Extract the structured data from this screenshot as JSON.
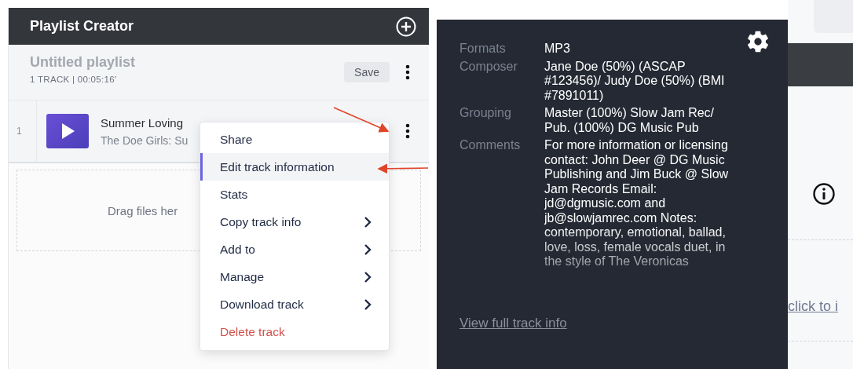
{
  "panel": {
    "title": "Playlist Creator",
    "playlist_name": "Untitled playlist",
    "summary": "1 TRACK | 00:05:16′",
    "save_label": "Save"
  },
  "tracks": [
    {
      "number": "1",
      "title": "Summer Loving",
      "subtitle": "The Doe Girls: Su"
    }
  ],
  "drop_zone": {
    "text": "Drag files her"
  },
  "context_menu": [
    {
      "label": "Share",
      "kind": "normal",
      "submenu": false,
      "selected": false
    },
    {
      "label": "Edit track information",
      "kind": "normal",
      "submenu": false,
      "selected": true
    },
    {
      "label": "Stats",
      "kind": "normal",
      "submenu": false,
      "selected": false
    },
    {
      "label": "Copy track info",
      "kind": "normal",
      "submenu": true,
      "selected": false
    },
    {
      "label": "Add to",
      "kind": "normal",
      "submenu": true,
      "selected": false
    },
    {
      "label": "Manage",
      "kind": "normal",
      "submenu": true,
      "selected": false
    },
    {
      "label": "Download track",
      "kind": "normal",
      "submenu": true,
      "selected": false
    },
    {
      "label": "Delete track",
      "kind": "danger",
      "submenu": false,
      "selected": false
    }
  ],
  "track_info": {
    "fields": [
      {
        "label": "Formats",
        "value": "MP3"
      },
      {
        "label": "Composer",
        "value": "Jane Doe (50%) (ASCAP #123456)/ Judy Doe (50%) (BMI #7891011)"
      },
      {
        "label": "Grouping",
        "value": "Master (100%) Slow Jam Rec/ Pub. (100%) DG Music Pub"
      },
      {
        "label": "Comments",
        "value": "For more information or licensing contact: John Deer @ DG Music Publishing and Jim Buck @ Slow Jam Records Email: jd@dgmusic.com and jb@slowjamrec.com Notes: contemporary, emotional, ballad, love, loss, female vocals duet, in the style of The Veronicas"
      }
    ],
    "link": "View full track info"
  },
  "background_app": {
    "link": "click to i"
  }
}
